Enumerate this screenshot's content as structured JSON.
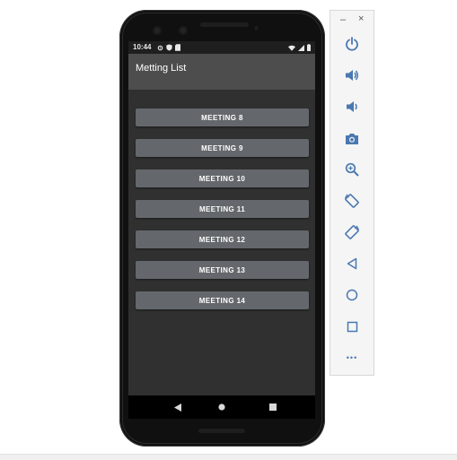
{
  "status_bar": {
    "time": "10:44"
  },
  "app_bar": {
    "title": "Metting List"
  },
  "meetings": [
    {
      "label": "MEETING 8"
    },
    {
      "label": "MEETING 9"
    },
    {
      "label": "MEETING 10"
    },
    {
      "label": "MEETING 11"
    },
    {
      "label": "MEETING 12"
    },
    {
      "label": "MEETING 13"
    },
    {
      "label": "MEETING 14"
    }
  ],
  "toolbar": {
    "minimize_label": "–",
    "close_label": "×",
    "more_label": "•••"
  },
  "icons": {
    "status_left": [
      "settings-icon",
      "shield-icon",
      "sd-card-icon"
    ],
    "status_right": [
      "wifi-icon",
      "signal-icon",
      "battery-icon"
    ],
    "nav": [
      "back-icon",
      "home-icon",
      "recents-icon"
    ],
    "toolbar": [
      "power-icon",
      "volume-up-icon",
      "volume-down-icon",
      "camera-icon",
      "zoom-icon",
      "rotate-left-icon",
      "rotate-right-icon",
      "back-icon",
      "home-icon",
      "overview-icon",
      "more-icon"
    ]
  },
  "colors": {
    "app_bar": "#4d4d4d",
    "screen_bg": "#303030",
    "button_bg": "#64686c",
    "toolbar_icon": "#4a78b0"
  }
}
